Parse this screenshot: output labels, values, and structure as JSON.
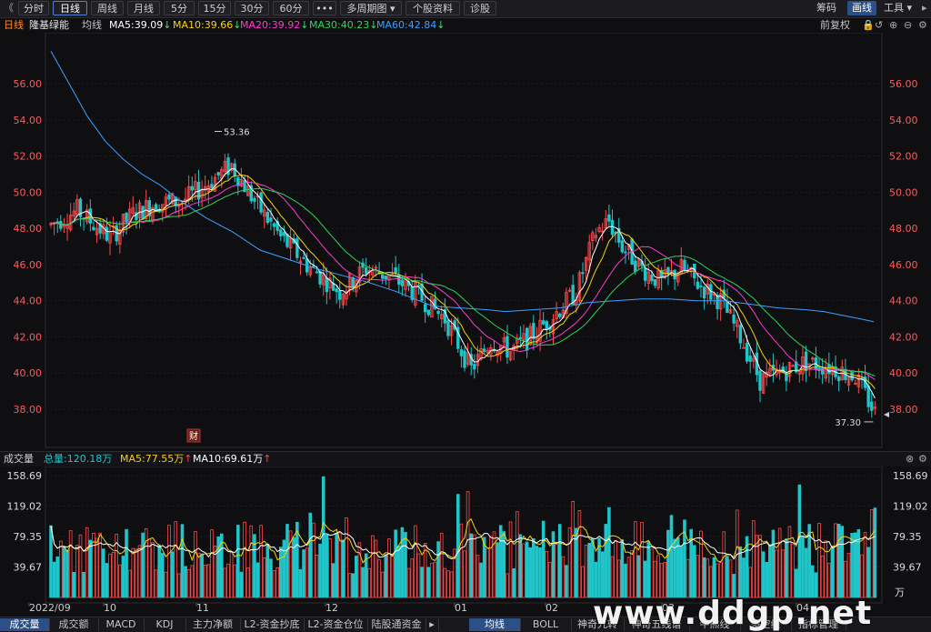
{
  "toolbar": {
    "back_label": "《",
    "tabs": [
      "分时",
      "日线",
      "周线",
      "月线",
      "5分",
      "15分",
      "30分",
      "60分",
      "•••",
      "多周期图 ▾",
      "个股资料",
      "诊股"
    ],
    "active_tab": "日线",
    "right": [
      "筹码",
      "画线",
      "工具 ▾"
    ],
    "right_active": "画线"
  },
  "info": {
    "period": "日线",
    "stock": "隆基绿能",
    "ma_label": "均线",
    "ma5": "MA5:39.09",
    "ma10": "MA10:39.66",
    "ma20": "MA20:39.92",
    "ma30": "MA30:40.23",
    "ma60": "MA60:42.84",
    "fq": "前复权",
    "arrow_down": "↓"
  },
  "colors": {
    "up": "#ff4a4a",
    "down": "#1fc5c9",
    "ma5": "#ffffff",
    "ma10": "#f5d20f",
    "ma20": "#ff3ad0",
    "ma30": "#2ed35a",
    "ma60": "#3aa0ff",
    "axis": "#ff5a5a"
  },
  "price_axis": [
    "56.00",
    "54.00",
    "52.00",
    "50.00",
    "48.00",
    "46.00",
    "44.00",
    "42.00",
    "40.00",
    "38.00"
  ],
  "annotations": {
    "high": "53.36",
    "low": "37.30",
    "event_marker": "财"
  },
  "volume": {
    "title": "成交量",
    "total": "总量:120.18万",
    "ma5": "MA5:77.55万",
    "ma10": "MA10:69.61万",
    "arrow_up": "↑",
    "axis": [
      "158.69",
      "119.02",
      "79.35",
      "39.67"
    ],
    "unit": "万"
  },
  "x_labels": [
    "2022/09",
    "10",
    "11",
    "12",
    "01",
    "02",
    "03",
    "04"
  ],
  "bottom_tabs_left": [
    "成交量",
    "成交额",
    "MACD",
    "KDJ",
    "主力净额",
    "L2-资金抄底",
    "L2-资金仓位",
    "陆股通资金",
    "▸"
  ],
  "bottom_tabs_right": [
    "均线",
    "BOLL",
    "神奇九转",
    "神奇五线谱",
    "牛熊线",
    "多空线",
    "指标管理"
  ],
  "bottom_active": [
    "成交量",
    "均线"
  ],
  "watermark": "www.ddgp.net",
  "chart_data": {
    "type": "candlestick",
    "title": "隆基绿能 日线",
    "ylim": [
      36.5,
      57.5
    ],
    "ma_series": [
      {
        "name": "MA5",
        "final": 39.09
      },
      {
        "name": "MA10",
        "final": 39.66
      },
      {
        "name": "MA20",
        "final": 39.92
      },
      {
        "name": "MA30",
        "final": 40.23
      },
      {
        "name": "MA60",
        "final": 42.84
      }
    ],
    "ma60_path": [
      [
        0,
        57.8
      ],
      [
        20,
        56
      ],
      [
        40,
        54.2
      ],
      [
        60,
        52.8
      ],
      [
        80,
        51.8
      ],
      [
        100,
        51
      ],
      [
        120,
        50.4
      ],
      [
        140,
        49.6
      ],
      [
        170,
        48.6
      ],
      [
        200,
        47.8
      ],
      [
        230,
        46.8
      ],
      [
        260,
        46.3
      ],
      [
        290,
        45.8
      ],
      [
        320,
        45.4
      ],
      [
        350,
        45
      ],
      [
        380,
        44.5
      ],
      [
        400,
        44.1
      ],
      [
        420,
        43.7
      ],
      [
        450,
        43.6
      ],
      [
        480,
        43.5
      ],
      [
        500,
        43.4
      ],
      [
        530,
        43.5
      ],
      [
        560,
        43.6
      ],
      [
        590,
        43.9
      ],
      [
        620,
        44.0
      ],
      [
        650,
        44.1
      ],
      [
        680,
        44.1
      ],
      [
        710,
        44.0
      ],
      [
        740,
        44.0
      ],
      [
        770,
        43.8
      ],
      [
        800,
        43.6
      ],
      [
        830,
        43.5
      ],
      [
        850,
        43.4
      ],
      [
        870,
        43.2
      ],
      [
        890,
        43.0
      ],
      [
        905,
        42.84
      ]
    ],
    "low_annotation": 37.3,
    "high_annotation": 53.36
  }
}
